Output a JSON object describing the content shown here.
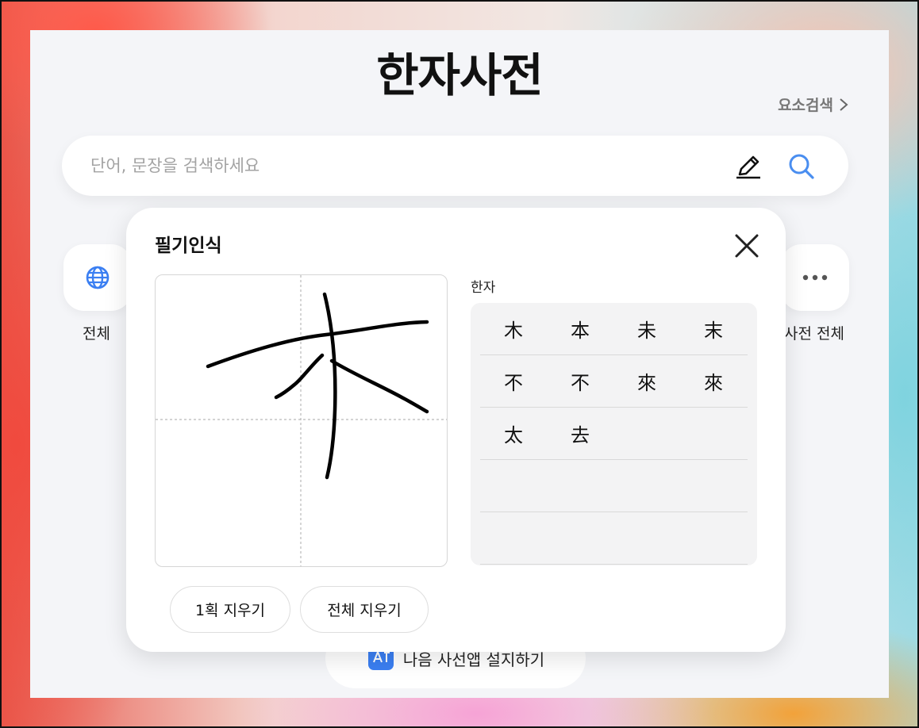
{
  "page": {
    "title": "한자사전"
  },
  "header": {
    "element_search_label": "요소검색",
    "element_search_icon": "chevron-right-icon"
  },
  "search": {
    "placeholder": "단어, 문장을 검색하세요",
    "value": "",
    "pen_icon": "pen-icon",
    "search_icon": "search-icon",
    "accent_color": "#4a8ef0"
  },
  "categories": [
    {
      "label": "전체",
      "icon": "globe-icon"
    },
    {
      "label": "사전 전체",
      "icon": "more-icon"
    }
  ],
  "install": {
    "label": "나음 사선앱 설지하기",
    "icon": "dictionary-app-icon"
  },
  "handwriting": {
    "title": "필기인식",
    "close_icon": "close-icon",
    "result_label": "한자",
    "candidates": [
      [
        "木",
        "本",
        "未",
        "末"
      ],
      [
        "不",
        "不",
        "來",
        "來"
      ],
      [
        "太",
        "去"
      ],
      [],
      []
    ],
    "undo_label": "1획 지우기",
    "clear_label": "전체 지우기"
  }
}
